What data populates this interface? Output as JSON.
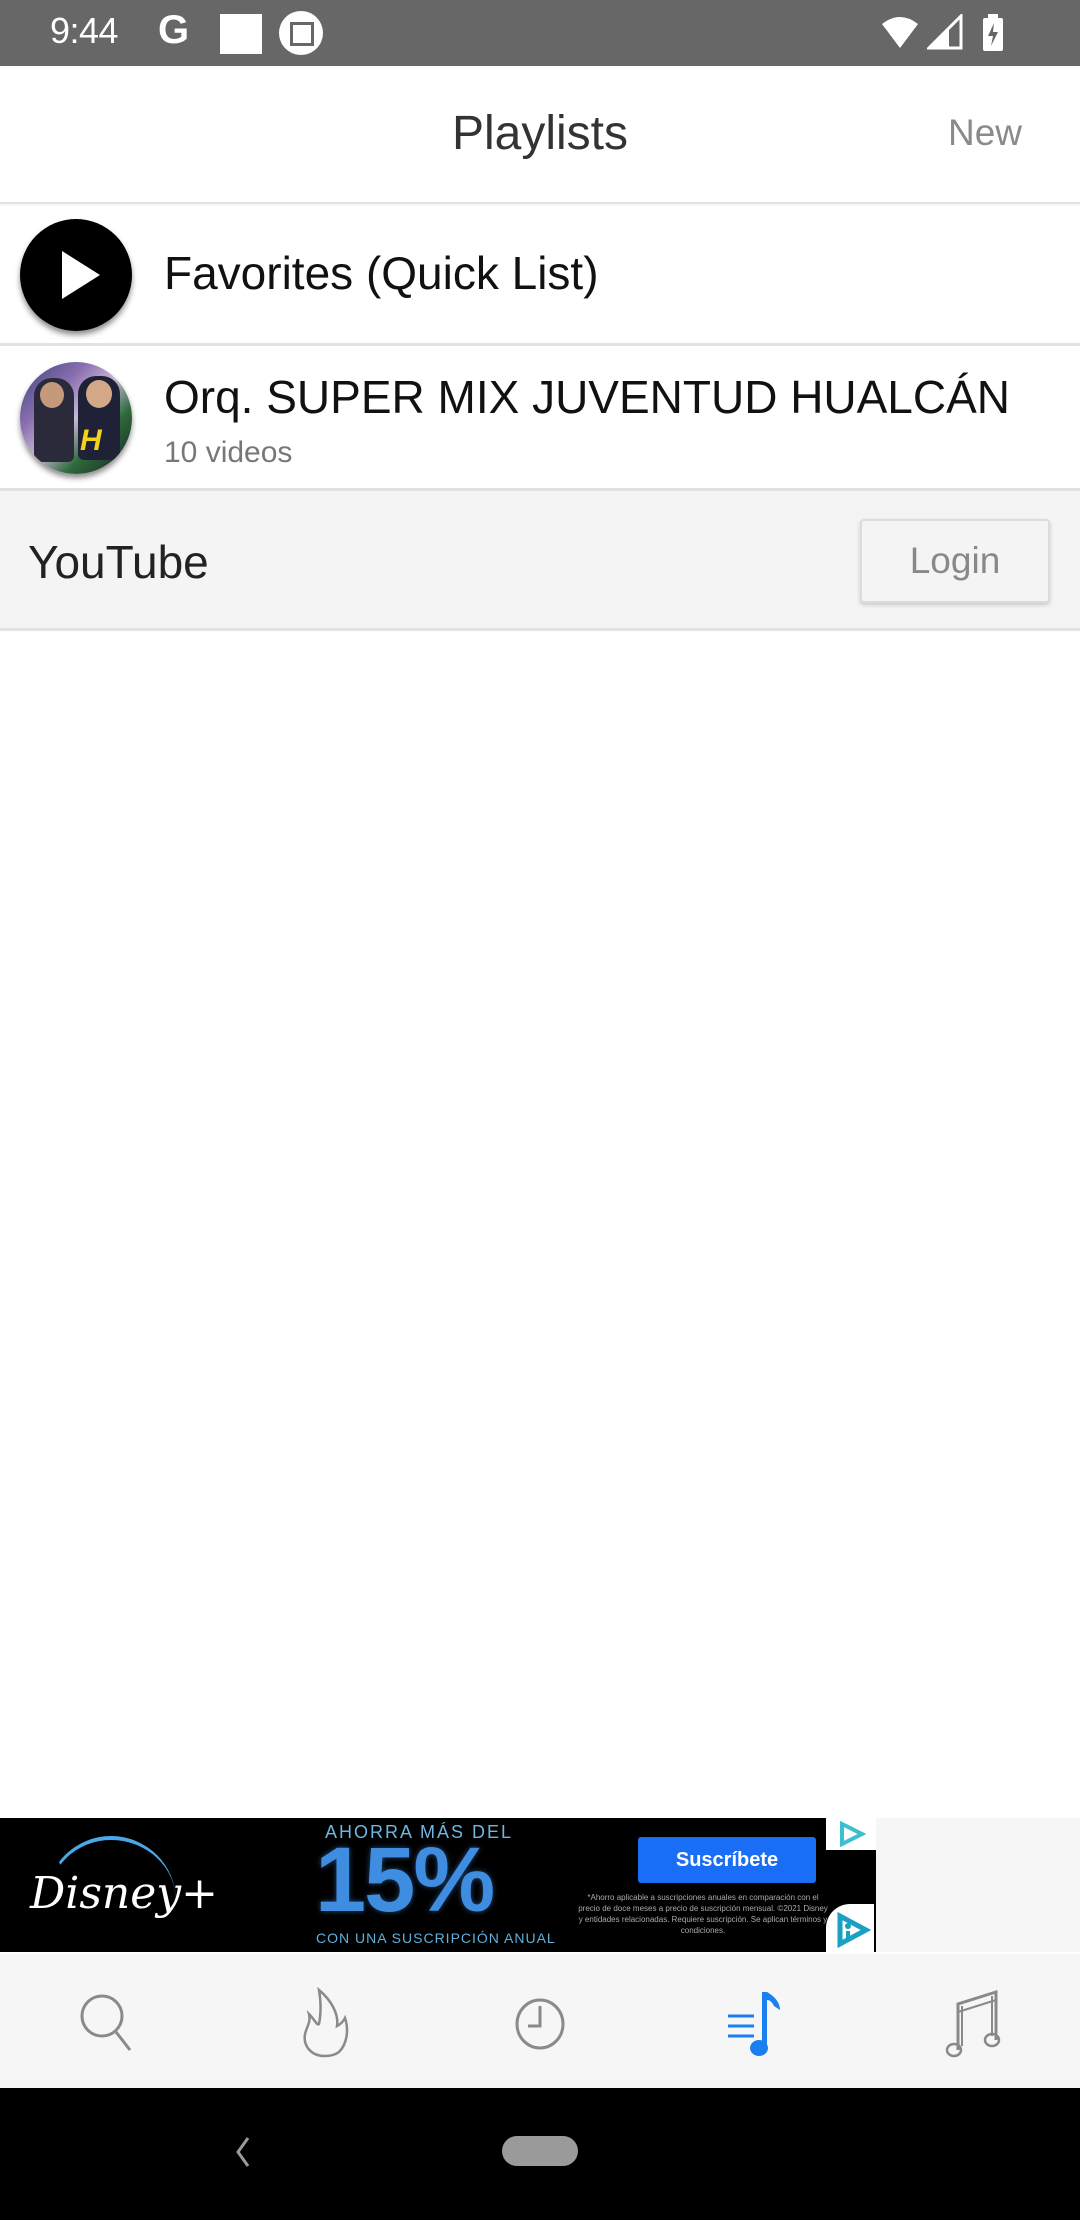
{
  "status_bar": {
    "time": "9:44",
    "notification_icons": [
      "google-icon",
      "square-icon",
      "screenshot-icon"
    ],
    "system_icons": [
      "wifi-icon",
      "signal-icon",
      "battery-charging-icon"
    ],
    "google_glyph": "G"
  },
  "app_bar": {
    "title": "Playlists",
    "new_label": "New"
  },
  "playlists": [
    {
      "title": "Favorites (Quick List)",
      "subtitle": "",
      "icon": "play-icon"
    },
    {
      "title": "Orq. SUPER MIX JUVENTUD HUALCÁN",
      "subtitle": "10 videos",
      "icon": "playlist-thumbnail",
      "thumb_logo": "H"
    }
  ],
  "youtube_section": {
    "label": "YouTube",
    "login_label": "Login"
  },
  "ad": {
    "brand": "Disney+",
    "headline_top": "AHORRA MÁS DEL",
    "headline_big": "15%",
    "headline_bottom": "CON UNA SUSCRIPCIÓN ANUAL",
    "cta": "Suscríbete",
    "fine_print": "*Ahorro aplicable a suscripciones anuales en comparación con el precio de doce meses a precio de suscripción mensual. ©2021 Disney y entidades relacionadas. Requiere suscripción. Se aplican términos y condiciones."
  },
  "tab_bar": {
    "tabs": [
      {
        "name": "search",
        "icon": "search-icon",
        "active": false
      },
      {
        "name": "trending",
        "icon": "flame-icon",
        "active": false
      },
      {
        "name": "history",
        "icon": "clock-icon",
        "active": false
      },
      {
        "name": "playlists",
        "icon": "playlist-music-icon",
        "active": true
      },
      {
        "name": "library",
        "icon": "music-note-icon",
        "active": false
      }
    ],
    "active_color": "#1a7ff0",
    "inactive_color": "#8a8a8a"
  },
  "nav_bar": {
    "buttons": [
      "back",
      "home"
    ]
  }
}
